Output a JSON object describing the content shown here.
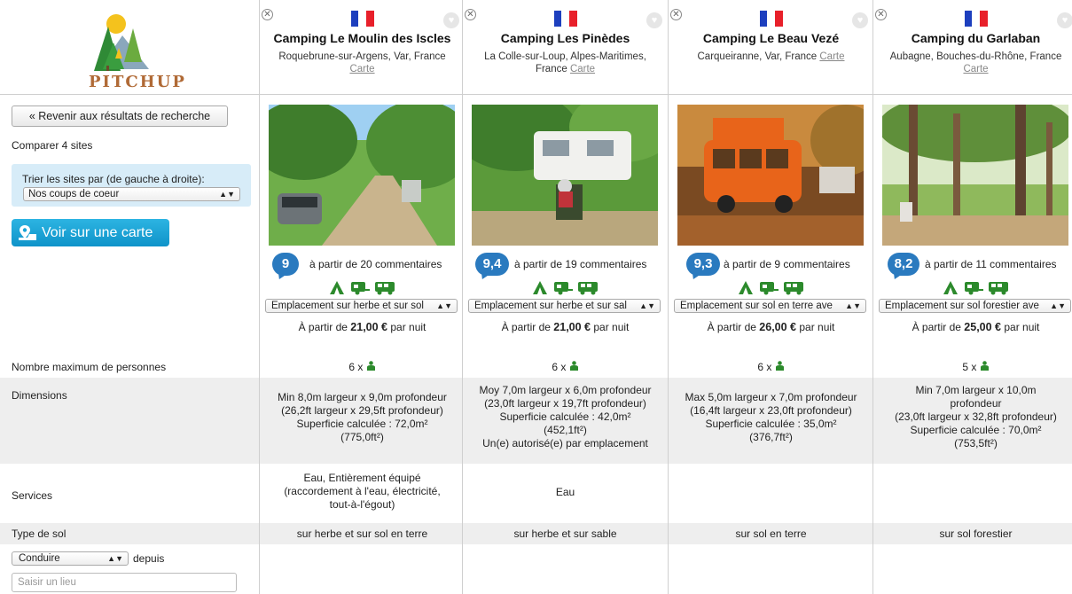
{
  "brand": {
    "logo_text": "PITCHUP"
  },
  "controls": {
    "back_label": "« Revenir aux résultats de recherche",
    "compare_text": "Comparer 4 sites",
    "sort_label": "Trier les sites par (de gauche à droite):",
    "sort_value": "Nos coups de coeur",
    "map_label": "Voir sur une carte",
    "travel_mode": "Conduire",
    "depuis": "depuis",
    "place_placeholder": "Saisir un lieu"
  },
  "row_labels": {
    "max_persons": "Nombre maximum de personnes",
    "dimensions": "Dimensions",
    "services": "Services",
    "soil": "Type de sol"
  },
  "colors": {
    "accent": "#2a7abf",
    "green": "#2c8a2c",
    "flag_blue": "#1d3fbe",
    "flag_red": "#e8202a"
  },
  "sites": [
    {
      "name": "Camping Le Moulin des Iscles",
      "location": "Roquebrune-sur-Argens, Var, France",
      "carte": "Carte",
      "rating": "9",
      "reviews": "à partir de 20 commentaires",
      "pitch": "Emplacement sur herbe et sur sol",
      "price_prefix": "À partir de",
      "price": "21,00 €",
      "price_suffix": "par nuit",
      "max_persons": "6 x",
      "dimensions": [
        "Min 8,0m largeur x 9,0m profondeur",
        "(26,2ft largeur x 29,5ft profondeur)",
        "Superficie calculée : 72,0m²",
        "(775,0ft²)"
      ],
      "services": [
        "Eau, Entièrement équipé",
        "(raccordement à l'eau, électricité,",
        "tout-à-l'égout)"
      ],
      "soil": "sur herbe et sur sol en terre"
    },
    {
      "name": "Camping Les Pinèdes",
      "location": "La Colle-sur-Loup, Alpes-Maritimes, France",
      "carte": "Carte",
      "rating": "9,4",
      "reviews": "à partir de 19 commentaires",
      "pitch": "Emplacement sur herbe et sur sal",
      "price_prefix": "À partir de",
      "price": "21,00 €",
      "price_suffix": "par nuit",
      "max_persons": "6 x",
      "dimensions": [
        "Moy 7,0m largeur x 6,0m profondeur",
        "(23,0ft largeur x 19,7ft profondeur)",
        "Superficie calculée : 42,0m²",
        "(452,1ft²)",
        "Un(e) autorisé(e) par emplacement"
      ],
      "services": [
        "Eau"
      ],
      "soil": "sur herbe et sur sable"
    },
    {
      "name": "Camping Le Beau Vezé",
      "location": "Carqueiranne, Var, France",
      "carte": "Carte",
      "rating": "9,3",
      "reviews": "à partir de 9 commentaires",
      "pitch": "Emplacement sur sol en terre ave",
      "price_prefix": "À partir de",
      "price": "26,00 €",
      "price_suffix": "par nuit",
      "max_persons": "6 x",
      "dimensions": [
        "Max 5,0m largeur x 7,0m profondeur",
        "(16,4ft largeur x 23,0ft profondeur)",
        "Superficie calculée : 35,0m²",
        "(376,7ft²)"
      ],
      "services": [],
      "soil": "sur sol en terre"
    },
    {
      "name": "Camping du Garlaban",
      "location": "Aubagne, Bouches-du-Rhône, France",
      "carte": "Carte",
      "rating": "8,2",
      "reviews": "à partir de 11 commentaires",
      "pitch": "Emplacement sur sol forestier ave",
      "price_prefix": "À partir de",
      "price": "25,00 €",
      "price_suffix": "par nuit",
      "max_persons": "5 x",
      "dimensions": [
        "Min 7,0m largeur x 10,0m",
        "profondeur",
        "(23,0ft largeur x 32,8ft profondeur)",
        "Superficie calculée : 70,0m²",
        "(753,5ft²)"
      ],
      "services": [],
      "soil": "sur sol forestier"
    }
  ]
}
